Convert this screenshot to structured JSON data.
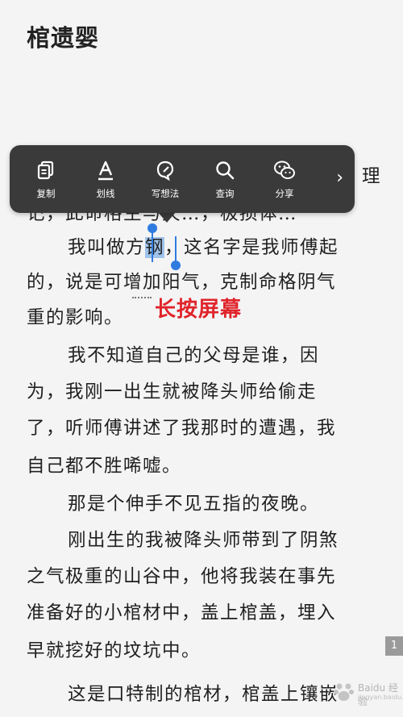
{
  "chapter": {
    "title": "棺遗婴"
  },
  "menu": {
    "items": [
      {
        "label": "复制",
        "icon": "copy-icon"
      },
      {
        "label": "划线",
        "icon": "underline-icon"
      },
      {
        "label": "写想法",
        "icon": "note-icon"
      },
      {
        "label": "查询",
        "icon": "search-icon"
      },
      {
        "label": "分享",
        "icon": "wechat-icon"
      }
    ],
    "more": "›"
  },
  "text": {
    "line1_tail": "理",
    "line2": "记，此命格生与天…，极损体…",
    "line3_pre": "我叫做方",
    "line3_sel": "钢",
    "line3_post": "，这名字是我师傅起",
    "lines": [
      "的，说是可增加阳气，克制命格阴气",
      "重的影响。",
      "我不知道自己的父母是谁，因",
      "为，我刚一出生就被降头师给偷走",
      "了，听师傅讲述了我那时的遭遇，我",
      "自己都不胜唏嘘。",
      "那是个伸手不见五指的夜晚。",
      "刚出生的我被降头师带到了阴煞",
      "之气极重的山谷中，他将我装在事先",
      "准备好的小棺材中，盖上棺盖，埋入",
      "早就挖好的坟坑中。",
      "这是口特制的棺材，棺盖上镶嵌"
    ]
  },
  "annotation": "长按屏幕",
  "page_badge": "1",
  "watermark": {
    "name": "Baidu 经验",
    "sub": "jingyan.baidu.com"
  },
  "colors": {
    "background": "#f4f4f5",
    "menu": "#3a3a3a",
    "selection": "#9fc3ea",
    "handle": "#2f7be0",
    "annotation": "#e0242a"
  }
}
